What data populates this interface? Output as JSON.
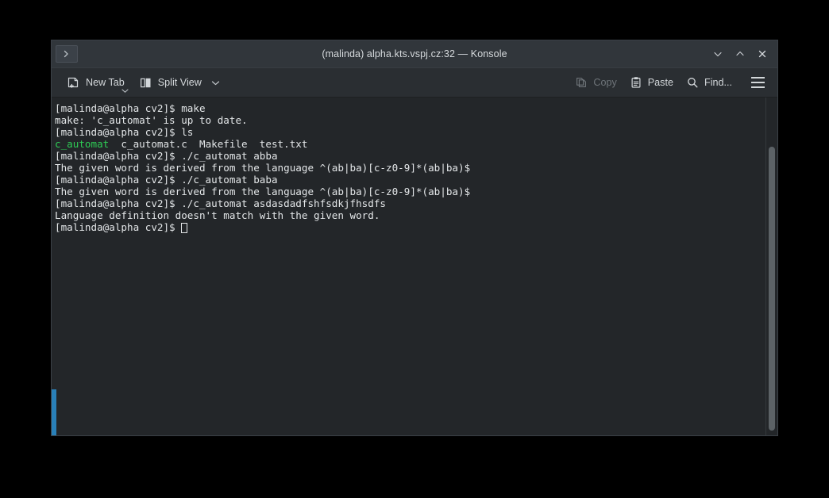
{
  "window": {
    "title": "(malinda) alpha.kts.vspj.cz:32 — Konsole",
    "tab_icon": "shell-prompt-icon",
    "controls": [
      {
        "name": "minimize",
        "icon": "chevron-down-icon"
      },
      {
        "name": "maximize",
        "icon": "chevron-up-icon"
      },
      {
        "name": "close",
        "icon": "close-x-icon"
      }
    ]
  },
  "toolbar": {
    "new_tab_label": "New Tab",
    "new_tab_icon": "new-tab-icon",
    "new_tab_caret_icon": "chevron-down-icon",
    "split_view_label": "Split View",
    "split_view_icon": "split-view-icon",
    "split_view_caret_icon": "chevron-down-icon",
    "copy_label": "Copy",
    "copy_icon": "copy-icon",
    "copy_disabled": true,
    "paste_label": "Paste",
    "paste_icon": "paste-clipboard-icon",
    "find_label": "Find...",
    "find_icon": "search-magnifier-icon",
    "menu_icon": "hamburger-menu-icon"
  },
  "terminal": {
    "background_color": "#232629",
    "foreground_color": "#e3e6e8",
    "executable_color": "#2ecc55",
    "accent_color": "#2980b9",
    "prompt": "[malinda@alpha cv2]$ ",
    "cursor": "block-outline",
    "lines": [
      {
        "text": "[malinda@alpha cv2]$ make"
      },
      {
        "text": "make: 'c_automat' is up to date."
      },
      {
        "text": "[malinda@alpha cv2]$ ls"
      },
      {
        "text": "c_automat  c_automat.c  Makefile  test.txt",
        "green_prefix": "c_automat"
      },
      {
        "text": "[malinda@alpha cv2]$ ./c_automat abba"
      },
      {
        "text": "The given word is derived from the language ^(ab|ba)[c-z0-9]*(ab|ba)$"
      },
      {
        "text": "[malinda@alpha cv2]$ ./c_automat baba"
      },
      {
        "text": "The given word is derived from the language ^(ab|ba)[c-z0-9]*(ab|ba)$"
      },
      {
        "text": "[malinda@alpha cv2]$ ./c_automat asdasdadfshfsdkjfhsdfs"
      },
      {
        "text": "Language definition doesn't match with the given word."
      },
      {
        "text": "[malinda@alpha cv2]$ ",
        "cursor": true
      }
    ]
  }
}
